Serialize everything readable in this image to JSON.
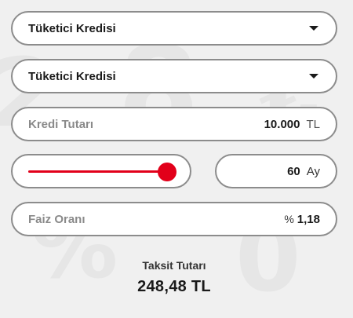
{
  "loan_type_primary": {
    "selected": "Tüketici Kredisi",
    "icon": "chevron-down-icon"
  },
  "loan_type_secondary": {
    "selected": "Tüketici Kredisi",
    "icon": "chevron-down-icon"
  },
  "amount": {
    "label": "Kredi Tutarı",
    "value": "10.000",
    "unit": "TL"
  },
  "term": {
    "slider_fraction": 0.95,
    "value": "60",
    "unit": "Ay"
  },
  "interest": {
    "label": "Faiz Oranı",
    "prefix": "%",
    "value": "1,18"
  },
  "result": {
    "label": "Taksit Tutarı",
    "value": "248,48 TL"
  },
  "colors": {
    "accent": "#e2001a",
    "border": "#8c8c8c",
    "background": "#f0f0f0"
  }
}
